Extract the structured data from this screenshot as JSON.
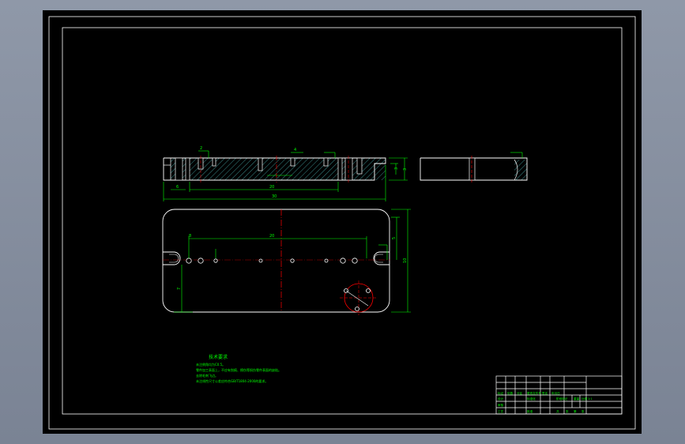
{
  "colors": {
    "background": "#000000",
    "border": "#ffffff",
    "outline": "#ffffff",
    "dimension": "#00ff00",
    "centerline": "#ff0000",
    "hatch": "#3a8a8a",
    "window": "#8f98a8"
  },
  "notes": {
    "title": "技术要求",
    "lines": [
      "未注倒角均为C0.5。",
      "零件加工表面上，不应有划痕、擦伤等损伤零件表面的缺陷。",
      "去除毛刺飞边。",
      "未注线性尺寸公差应符合GB/T1804-2000的要求。"
    ]
  },
  "dims": {
    "overall_length": "30",
    "middle_length": "20",
    "left_offset": "6",
    "plan_top": "20",
    "plan_left": "8",
    "plan_height": "10",
    "plan_side": "5",
    "plan_side2": "7",
    "side_height": "3",
    "hole_top": "2",
    "hole_mid": "4",
    "right_top": "3"
  },
  "title_block": {
    "cells": [
      "标记",
      "处数",
      "分区",
      "更改文件号",
      "签名",
      "年月日",
      "设计",
      "标准化",
      "审核",
      "工艺",
      "批准",
      "阶段标记",
      "重量",
      "比例",
      "1:1",
      "共",
      "张",
      "第",
      "张"
    ]
  }
}
